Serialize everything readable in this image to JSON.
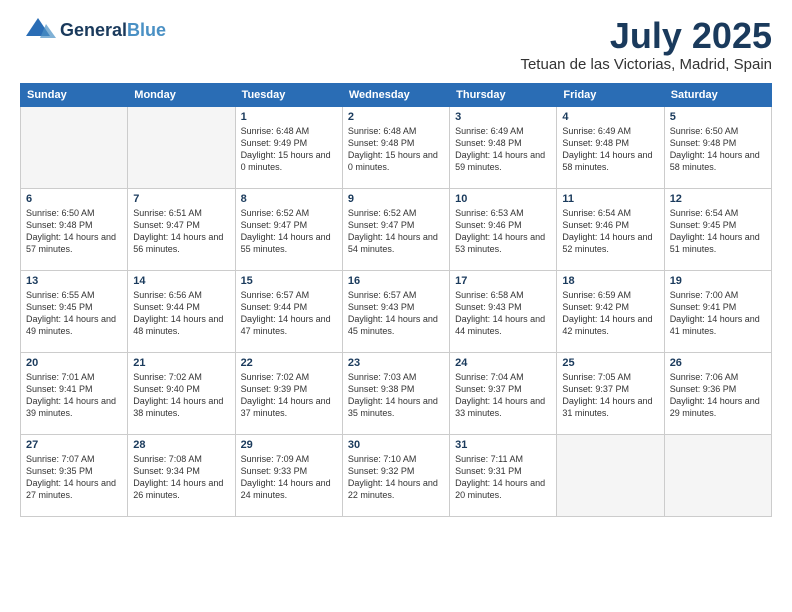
{
  "header": {
    "logo_general": "General",
    "logo_blue": "Blue",
    "month_title": "July 2025",
    "location": "Tetuan de las Victorias, Madrid, Spain"
  },
  "weekdays": [
    "Sunday",
    "Monday",
    "Tuesday",
    "Wednesday",
    "Thursday",
    "Friday",
    "Saturday"
  ],
  "weeks": [
    [
      {
        "day": "",
        "sunrise": "",
        "sunset": "",
        "daylight": ""
      },
      {
        "day": "",
        "sunrise": "",
        "sunset": "",
        "daylight": ""
      },
      {
        "day": "1",
        "sunrise": "Sunrise: 6:48 AM",
        "sunset": "Sunset: 9:49 PM",
        "daylight": "Daylight: 15 hours and 0 minutes."
      },
      {
        "day": "2",
        "sunrise": "Sunrise: 6:48 AM",
        "sunset": "Sunset: 9:48 PM",
        "daylight": "Daylight: 15 hours and 0 minutes."
      },
      {
        "day": "3",
        "sunrise": "Sunrise: 6:49 AM",
        "sunset": "Sunset: 9:48 PM",
        "daylight": "Daylight: 14 hours and 59 minutes."
      },
      {
        "day": "4",
        "sunrise": "Sunrise: 6:49 AM",
        "sunset": "Sunset: 9:48 PM",
        "daylight": "Daylight: 14 hours and 58 minutes."
      },
      {
        "day": "5",
        "sunrise": "Sunrise: 6:50 AM",
        "sunset": "Sunset: 9:48 PM",
        "daylight": "Daylight: 14 hours and 58 minutes."
      }
    ],
    [
      {
        "day": "6",
        "sunrise": "Sunrise: 6:50 AM",
        "sunset": "Sunset: 9:48 PM",
        "daylight": "Daylight: 14 hours and 57 minutes."
      },
      {
        "day": "7",
        "sunrise": "Sunrise: 6:51 AM",
        "sunset": "Sunset: 9:47 PM",
        "daylight": "Daylight: 14 hours and 56 minutes."
      },
      {
        "day": "8",
        "sunrise": "Sunrise: 6:52 AM",
        "sunset": "Sunset: 9:47 PM",
        "daylight": "Daylight: 14 hours and 55 minutes."
      },
      {
        "day": "9",
        "sunrise": "Sunrise: 6:52 AM",
        "sunset": "Sunset: 9:47 PM",
        "daylight": "Daylight: 14 hours and 54 minutes."
      },
      {
        "day": "10",
        "sunrise": "Sunrise: 6:53 AM",
        "sunset": "Sunset: 9:46 PM",
        "daylight": "Daylight: 14 hours and 53 minutes."
      },
      {
        "day": "11",
        "sunrise": "Sunrise: 6:54 AM",
        "sunset": "Sunset: 9:46 PM",
        "daylight": "Daylight: 14 hours and 52 minutes."
      },
      {
        "day": "12",
        "sunrise": "Sunrise: 6:54 AM",
        "sunset": "Sunset: 9:45 PM",
        "daylight": "Daylight: 14 hours and 51 minutes."
      }
    ],
    [
      {
        "day": "13",
        "sunrise": "Sunrise: 6:55 AM",
        "sunset": "Sunset: 9:45 PM",
        "daylight": "Daylight: 14 hours and 49 minutes."
      },
      {
        "day": "14",
        "sunrise": "Sunrise: 6:56 AM",
        "sunset": "Sunset: 9:44 PM",
        "daylight": "Daylight: 14 hours and 48 minutes."
      },
      {
        "day": "15",
        "sunrise": "Sunrise: 6:57 AM",
        "sunset": "Sunset: 9:44 PM",
        "daylight": "Daylight: 14 hours and 47 minutes."
      },
      {
        "day": "16",
        "sunrise": "Sunrise: 6:57 AM",
        "sunset": "Sunset: 9:43 PM",
        "daylight": "Daylight: 14 hours and 45 minutes."
      },
      {
        "day": "17",
        "sunrise": "Sunrise: 6:58 AM",
        "sunset": "Sunset: 9:43 PM",
        "daylight": "Daylight: 14 hours and 44 minutes."
      },
      {
        "day": "18",
        "sunrise": "Sunrise: 6:59 AM",
        "sunset": "Sunset: 9:42 PM",
        "daylight": "Daylight: 14 hours and 42 minutes."
      },
      {
        "day": "19",
        "sunrise": "Sunrise: 7:00 AM",
        "sunset": "Sunset: 9:41 PM",
        "daylight": "Daylight: 14 hours and 41 minutes."
      }
    ],
    [
      {
        "day": "20",
        "sunrise": "Sunrise: 7:01 AM",
        "sunset": "Sunset: 9:41 PM",
        "daylight": "Daylight: 14 hours and 39 minutes."
      },
      {
        "day": "21",
        "sunrise": "Sunrise: 7:02 AM",
        "sunset": "Sunset: 9:40 PM",
        "daylight": "Daylight: 14 hours and 38 minutes."
      },
      {
        "day": "22",
        "sunrise": "Sunrise: 7:02 AM",
        "sunset": "Sunset: 9:39 PM",
        "daylight": "Daylight: 14 hours and 37 minutes."
      },
      {
        "day": "23",
        "sunrise": "Sunrise: 7:03 AM",
        "sunset": "Sunset: 9:38 PM",
        "daylight": "Daylight: 14 hours and 35 minutes."
      },
      {
        "day": "24",
        "sunrise": "Sunrise: 7:04 AM",
        "sunset": "Sunset: 9:37 PM",
        "daylight": "Daylight: 14 hours and 33 minutes."
      },
      {
        "day": "25",
        "sunrise": "Sunrise: 7:05 AM",
        "sunset": "Sunset: 9:37 PM",
        "daylight": "Daylight: 14 hours and 31 minutes."
      },
      {
        "day": "26",
        "sunrise": "Sunrise: 7:06 AM",
        "sunset": "Sunset: 9:36 PM",
        "daylight": "Daylight: 14 hours and 29 minutes."
      }
    ],
    [
      {
        "day": "27",
        "sunrise": "Sunrise: 7:07 AM",
        "sunset": "Sunset: 9:35 PM",
        "daylight": "Daylight: 14 hours and 27 minutes."
      },
      {
        "day": "28",
        "sunrise": "Sunrise: 7:08 AM",
        "sunset": "Sunset: 9:34 PM",
        "daylight": "Daylight: 14 hours and 26 minutes."
      },
      {
        "day": "29",
        "sunrise": "Sunrise: 7:09 AM",
        "sunset": "Sunset: 9:33 PM",
        "daylight": "Daylight: 14 hours and 24 minutes."
      },
      {
        "day": "30",
        "sunrise": "Sunrise: 7:10 AM",
        "sunset": "Sunset: 9:32 PM",
        "daylight": "Daylight: 14 hours and 22 minutes."
      },
      {
        "day": "31",
        "sunrise": "Sunrise: 7:11 AM",
        "sunset": "Sunset: 9:31 PM",
        "daylight": "Daylight: 14 hours and 20 minutes."
      },
      {
        "day": "",
        "sunrise": "",
        "sunset": "",
        "daylight": ""
      },
      {
        "day": "",
        "sunrise": "",
        "sunset": "",
        "daylight": ""
      }
    ]
  ]
}
